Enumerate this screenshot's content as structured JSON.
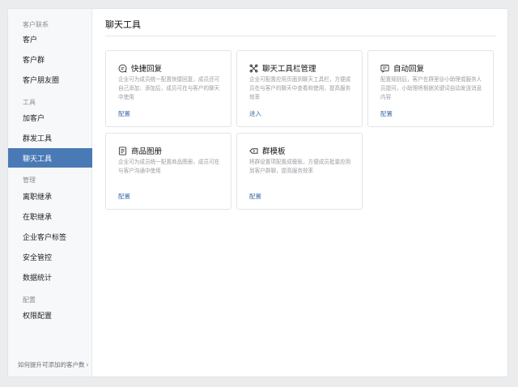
{
  "sidebar": {
    "groups": [
      {
        "title": "客户联系",
        "items": [
          "客户",
          "客户群",
          "客户朋友圈"
        ]
      },
      {
        "title": "工具",
        "items": [
          "加客户",
          "群发工具",
          "聊天工具"
        ]
      },
      {
        "title": "管理",
        "items": [
          "离职继承",
          "在职继承",
          "企业客户标签",
          "安全管控",
          "数据统计"
        ]
      },
      {
        "title": "配置",
        "items": [
          "权限配置"
        ]
      }
    ],
    "active_item": "聊天工具",
    "footer_link": "如何提升可添加的客户数",
    "footer_chevron": "›"
  },
  "main": {
    "title": "聊天工具",
    "cards": [
      {
        "icon": "quick-reply-icon",
        "title": "快捷回复",
        "desc": "企业可为成员统一配置快捷回复，成员还可自己添加、添加后，成员可在与客户的聊天中使用",
        "action": "配置"
      },
      {
        "icon": "toolbar-icon",
        "title": "聊天工具栏管理",
        "desc": "企业可配置应用页面到聊天工具栏，方便成员在与客户的聊天中查看和使用，提高服务效率",
        "action": "进入"
      },
      {
        "icon": "auto-reply-icon",
        "title": "自动回复",
        "desc": "配置规则后，客户在群里@小助理或服务人员提问，小助理将根据关键词自动发送消息内容",
        "action": "配置"
      },
      {
        "icon": "catalog-icon",
        "title": "商品图册",
        "desc": "企业可为成员统一配置商品图册，成员可在与客户沟通中使用",
        "action": "配置"
      },
      {
        "icon": "group-template-icon",
        "title": "群模板",
        "desc": "将群设置项配置成模板，方便成员批量应用到客户群聊，提高服务效率",
        "action": "配置"
      }
    ]
  },
  "colors": {
    "accent": "#4a7ab5",
    "link": "#3d6aa8"
  }
}
